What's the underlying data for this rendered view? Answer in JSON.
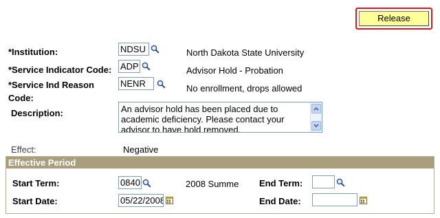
{
  "toolbar": {
    "release_label": "Release"
  },
  "fields": {
    "institution": {
      "label": "*Institution:",
      "value": "NDSU",
      "description": "North Dakota State University"
    },
    "service_indicator": {
      "label": "*Service Indicator Code:",
      "value": "ADP",
      "description": "Advisor Hold - Probation"
    },
    "service_reason": {
      "label": "*Service Ind Reason",
      "label_line2": "Code:",
      "value": "NENR",
      "description": "No enrollment, drops allowed"
    },
    "description": {
      "label": "Description:",
      "value": "An advisor hold has been placed due to academic deficiency.  Please contact your advisor to have hold removed."
    },
    "effect": {
      "label": "Effect:",
      "value": "Negative"
    }
  },
  "effective_period": {
    "title": "Effective Period",
    "start_term": {
      "label": "Start Term:",
      "value": "0840",
      "description": "2008 Summe"
    },
    "end_term": {
      "label": "End Term:",
      "value": ""
    },
    "start_date": {
      "label": "Start Date:",
      "value": "05/22/2008"
    },
    "end_date": {
      "label": "End Date:",
      "value": ""
    }
  },
  "icons": {
    "lookup": "magnifier-lookup-icon",
    "calendar": "calendar-icon"
  }
}
